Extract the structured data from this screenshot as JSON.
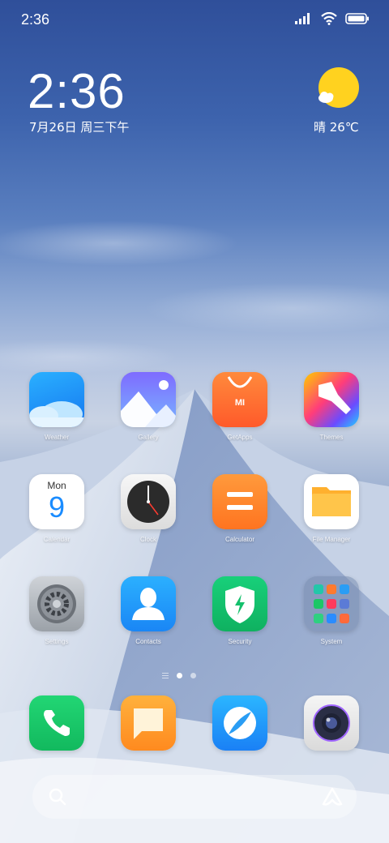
{
  "status_bar": {
    "time": "2:36"
  },
  "clock_widget": {
    "time": "2:36",
    "date": "7月26日 周三下午"
  },
  "weather_widget": {
    "text": "晴 26℃",
    "icon": "sun-cloud-icon"
  },
  "apps": [
    {
      "label": "Weather",
      "icon": "weather-icon"
    },
    {
      "label": "Gallery",
      "icon": "gallery-icon"
    },
    {
      "label": "GetApps",
      "icon": "getapps-icon"
    },
    {
      "label": "Themes",
      "icon": "themes-icon"
    },
    {
      "label": "Calendar",
      "icon": "calendar-icon",
      "day_name": "Mon",
      "day_number": "9"
    },
    {
      "label": "Clock",
      "icon": "clock-icon"
    },
    {
      "label": "Calculator",
      "icon": "calculator-icon"
    },
    {
      "label": "File Manager",
      "icon": "folder-icon"
    },
    {
      "label": "Settings",
      "icon": "gear-icon"
    },
    {
      "label": "Contacts",
      "icon": "contacts-icon"
    },
    {
      "label": "Security",
      "icon": "shield-icon"
    },
    {
      "label": "System",
      "icon": "folder-group-icon"
    }
  ],
  "getapps_badge": "MI",
  "dock": [
    {
      "icon": "phone-icon"
    },
    {
      "icon": "messages-icon"
    },
    {
      "icon": "browser-icon"
    },
    {
      "icon": "camera-icon"
    }
  ],
  "page_indicator": {
    "pages": 2,
    "active": 1
  },
  "search_bar": {
    "icon": "search-icon",
    "assistant_icon": "assistant-icon"
  },
  "colors": {
    "green": "#1cc766",
    "orange": "#ff7a2e",
    "blue": "#1a9bff"
  }
}
